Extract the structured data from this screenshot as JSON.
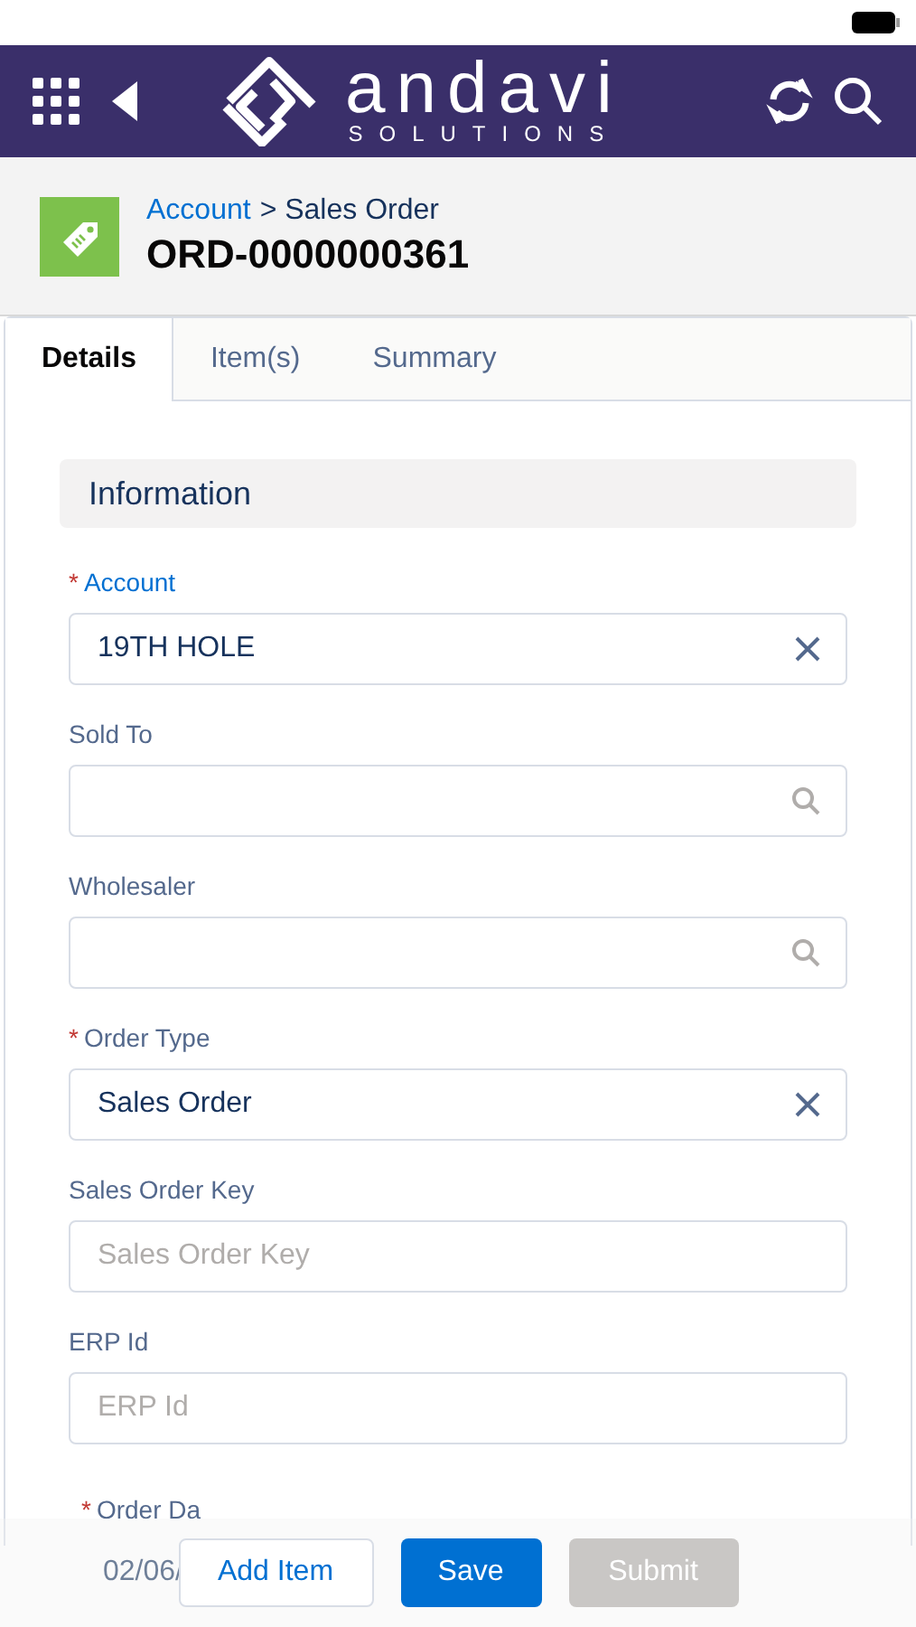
{
  "header": {
    "logo_word": "andavi",
    "logo_sub": "SOLUTIONS"
  },
  "record": {
    "breadcrumb_link": "Account",
    "breadcrumb_rest": "> Sales Order",
    "title": "ORD-0000000361"
  },
  "tabs": [
    {
      "label": "Details",
      "selected": true
    },
    {
      "label": "Item(s)",
      "selected": false
    },
    {
      "label": "Summary",
      "selected": false
    }
  ],
  "section": {
    "title": "Information"
  },
  "fields": [
    {
      "label": "Account",
      "required_mark": "*",
      "focused": true,
      "kind": "clearable",
      "value": "19TH HOLE"
    },
    {
      "label": "Sold To",
      "focused": false,
      "kind": "lookup"
    },
    {
      "label": "Wholesaler",
      "focused": false,
      "kind": "lookup"
    },
    {
      "label": "Order Type",
      "required_mark": "*",
      "focused": false,
      "kind": "clearable",
      "value": "Sales Order"
    },
    {
      "label": "Sales Order Key",
      "focused": false,
      "kind": "text",
      "placeholder": "Sales Order Key"
    },
    {
      "label": "ERP Id",
      "focused": false,
      "kind": "text",
      "placeholder": "ERP Id"
    }
  ],
  "partial_field": {
    "label": "Order Da",
    "required_mark": "*",
    "value": "02/06/"
  },
  "buttons": [
    {
      "label": "Add Item",
      "kind": "outline",
      "disabled": false
    },
    {
      "label": "Save",
      "kind": "brand",
      "disabled": false
    },
    {
      "label": "Submit",
      "kind": "brand",
      "disabled": true
    }
  ]
}
